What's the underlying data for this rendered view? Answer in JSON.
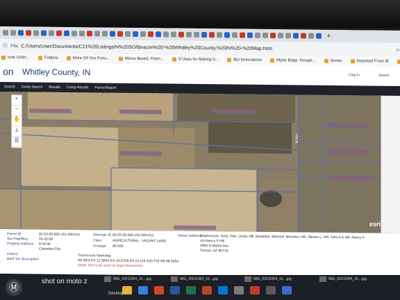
{
  "browser": {
    "file_label": "File",
    "url": "C:/Users/User/Documents/C21%20Listings/N%20SO/Beacon%20-%20Whitley%20County,%20IN%20-%20Map.html",
    "bookmarks": [
      "ools Onlin...",
      "Folders",
      "More Of You Fortu...",
      "Minox Beard, Prem...",
      "5 Uses for Baking S...",
      "Bio Innovations",
      "Mylar Bags: Inexpe...",
      "Vortex",
      "Imported From IE",
      "dotloop"
    ]
  },
  "header": {
    "logo": "on",
    "county": "Whitley County, IN",
    "login": "Clog In",
    "search": "Search"
  },
  "nav": [
    "Search",
    "Comp Search",
    "Results",
    "Comp Results",
    "Parcel Report"
  ],
  "map": {
    "parcel_labels": [
      "92-03-20-000-109.000-011",
      "92-03-20-000-108.000-011",
      "92-03-20-000-106.000-011",
      "92-03-20-000-107.000-011",
      "92-03-20-000-101.000-011",
      "92-03-20-000-102.000-011",
      "92-03-20-000-103.000-011",
      "92-03-21-000-014.000-011"
    ],
    "road_label": "450 N",
    "attribution": "esri"
  },
  "info": {
    "parcel_id_label": "Parcel ID",
    "parcel_id": "92-03-20-000-101.000-011",
    "sec_label": "Sec/Twp/Rng",
    "sec": "20-32-09",
    "addr_label": "Property Address",
    "addr": "N 50 W",
    "city": "Columbia City",
    "district_label": "District",
    "brief_label": "Brief Tax Description",
    "alt_label": "Alternate ID",
    "alt": "92-03-20-000-101.000-011",
    "class_label": "Class",
    "class": "AGRICULTURAL - VACANT LAND",
    "acreage_label": "Acreage",
    "acreage": "88.026",
    "owner_label": "Owner Address",
    "owner": "Stephenson, Terry, Trier, Linda; Hill, Madeline; Warnick, Brenden; Hill, Steven L; Hill, John A & Hill, Nancy F",
    "owner2": "c/o Nancy F Hill",
    "owner3": "2605 N Martin Ave",
    "owner4": "Tucson, AZ 85719",
    "township": "Thorncreek Township",
    "legal": "N2 NE4 EX 12.383A EX 14.575A EX 12.116 S20 T32 R9 88.026A",
    "note": "(Note: Not to be used on legal documents)"
  },
  "taskbar": {
    "watermark": "shot on moto z",
    "desktop": "Desktop",
    "items": [
      "IMG_20211004_15....jpg",
      "IMG_20211004_15....jpg",
      "IMG_20211004_15....jpg",
      "IMG_20211004_15....jpg"
    ]
  }
}
